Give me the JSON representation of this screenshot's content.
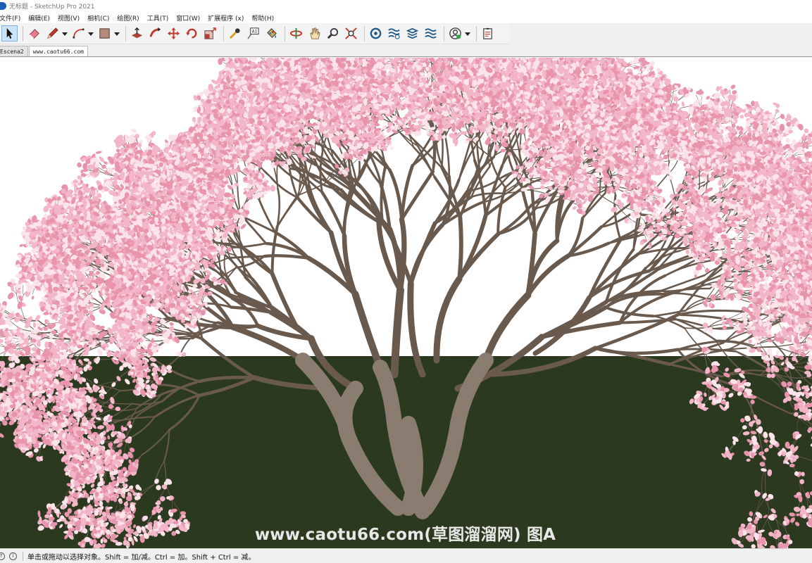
{
  "window": {
    "title": "无标题 - SketchUp Pro 2021"
  },
  "menu": {
    "items": [
      "文件(F)",
      "编辑(E)",
      "视图(V)",
      "相机(C)",
      "绘图(R)",
      "工具(T)",
      "窗口(W)",
      "扩展程序 (x)",
      "帮助(H)"
    ]
  },
  "toolbar": {
    "tools": [
      "select-tool",
      "eraser-tool",
      "pencil-tool",
      "arc-tool",
      "shape-tool",
      "push-pull-tool",
      "follow-me-tool",
      "move-tool",
      "rotate-tool",
      "scale-tool",
      "tape-measure-tool",
      "text-tool",
      "paint-bucket-tool",
      "orbit-tool",
      "pan-tool",
      "zoom-tool",
      "zoom-extents-tool",
      "warehouse-tool",
      "extension-warehouse-tool",
      "layout-tool",
      "extension-manager-tool",
      "account-tool",
      "report-tool"
    ]
  },
  "tabs": [
    {
      "label": "Escena2"
    },
    {
      "label": "www.caotu66.com"
    }
  ],
  "viewport": {
    "watermark": "www.caotu66.com(草图溜溜网) 图A",
    "colors": {
      "sky": "#ffffff",
      "ground": "#2b3a1f",
      "blossom": "#f2b6c8",
      "bark": "#6a5a4e"
    }
  },
  "status": {
    "text": "单击或拖动以选择对象。Shift = 加/减。Ctrl = 加。Shift + Ctrl = 减。"
  }
}
